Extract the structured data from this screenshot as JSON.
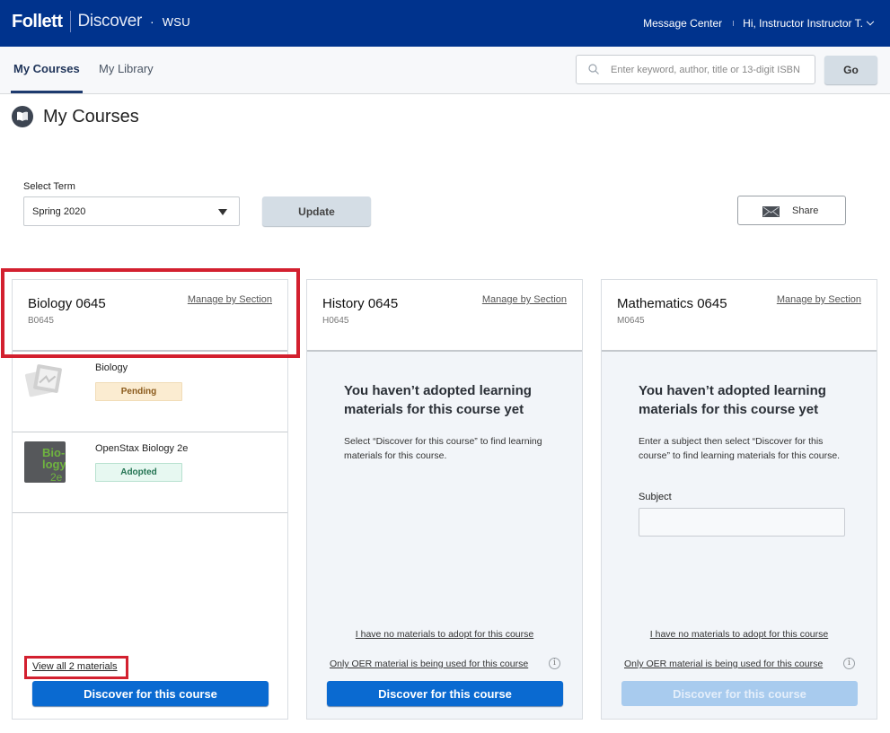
{
  "header": {
    "brand": "Follett",
    "product": "Discover",
    "separator": "·",
    "school": "WSU",
    "message_center": "Message Center",
    "user_greeting": "Hi, Instructor Instructor T.",
    "brand_color": "#00338d"
  },
  "nav": {
    "tabs": [
      {
        "label": "My Courses",
        "active": true
      },
      {
        "label": "My Library",
        "active": false
      }
    ],
    "search_placeholder": "Enter keyword, author, title or 13-digit ISBN",
    "search_value": "",
    "go_label": "Go"
  },
  "page": {
    "title": "My Courses",
    "icon": "book-icon"
  },
  "term": {
    "label": "Select Term",
    "selected": "Spring 2020",
    "update_label": "Update",
    "share_label": "Share"
  },
  "courses": [
    {
      "name": "Biology 0645",
      "code": "B0645",
      "manage_label": "Manage by Section",
      "materials": [
        {
          "title": "Biology",
          "status": "Pending",
          "thumb": "placeholder-image"
        },
        {
          "title": "OpenStax Biology 2e",
          "status": "Adopted",
          "thumb": "openstax-cover",
          "cover_text": [
            "Bio-",
            "logy",
            "2e"
          ]
        }
      ],
      "view_all_label": "View all 2 materials",
      "discover_label": "Discover for this course",
      "discover_enabled": true
    },
    {
      "name": "History 0645",
      "code": "H0645",
      "manage_label": "Manage by Section",
      "empty_title": "You haven’t adopted learning materials for this course yet",
      "empty_desc": "Select “Discover for this course” to find learning materials for this course.",
      "no_materials_label": "I have no materials to adopt for this course",
      "oer_label": "Only OER material is being used for this course",
      "discover_label": "Discover for this course",
      "discover_enabled": true
    },
    {
      "name": "Mathematics 0645",
      "code": "M0645",
      "manage_label": "Manage by Section",
      "empty_title": "You haven’t adopted learning materials for this course yet",
      "empty_desc": "Enter a subject then select “Discover for this course” to find learning materials for this course.",
      "subject_label": "Subject",
      "subject_value": "",
      "no_materials_label": "I have no materials to adopt for this course",
      "oer_label": "Only OER material is being used for this course",
      "discover_label": "Discover for this course",
      "discover_enabled": false
    }
  ],
  "colors": {
    "primary_button": "#0a6ad1",
    "disabled_button": "#a8cbee",
    "pending_bg": "#fbecd1",
    "adopted_bg": "#e7f8f1",
    "highlight": "#d3202f"
  }
}
